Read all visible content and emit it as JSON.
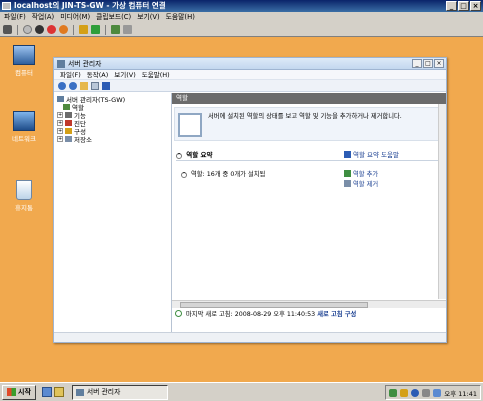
{
  "vm": {
    "title": "localhost의 JIN-TS-GW - 가상 컴퓨터 연결",
    "menu": [
      "파일(F)",
      "작업(A)",
      "미디어(M)",
      "클립보드(C)",
      "보기(V)",
      "도움말(H)"
    ]
  },
  "desktop": {
    "icons": [
      "컴퓨터",
      "네트워크",
      "휴지통"
    ]
  },
  "server_manager": {
    "title": "서버 관리자",
    "menu": [
      "파일(F)",
      "동작(A)",
      "보기(V)",
      "도움말(H)"
    ],
    "tree": {
      "root": "서버 관리자(TS-GW)",
      "items": [
        "역할",
        "기능",
        "진단",
        "구성",
        "저장소"
      ]
    },
    "content": {
      "header": "역할",
      "description": "서버에 설치된 역할의 상태를 보고 역할 및 기능을 추가하거나 제거합니다.",
      "section_title": "역할 요약",
      "help_link": "역할 요약 도움말",
      "roles_count": "역할: 16개 중 0개가 설치됨",
      "add_role": "역할 추가",
      "remove_role": "역할 제거"
    },
    "status": {
      "last_refresh": "마지막 새로 고침: 2008-08-29 오후 11:40:53",
      "configure_link": "새로 고침 구성"
    }
  },
  "taskbar": {
    "start": "시작",
    "task": "서버 관리자",
    "clock": "오후 11:41"
  }
}
